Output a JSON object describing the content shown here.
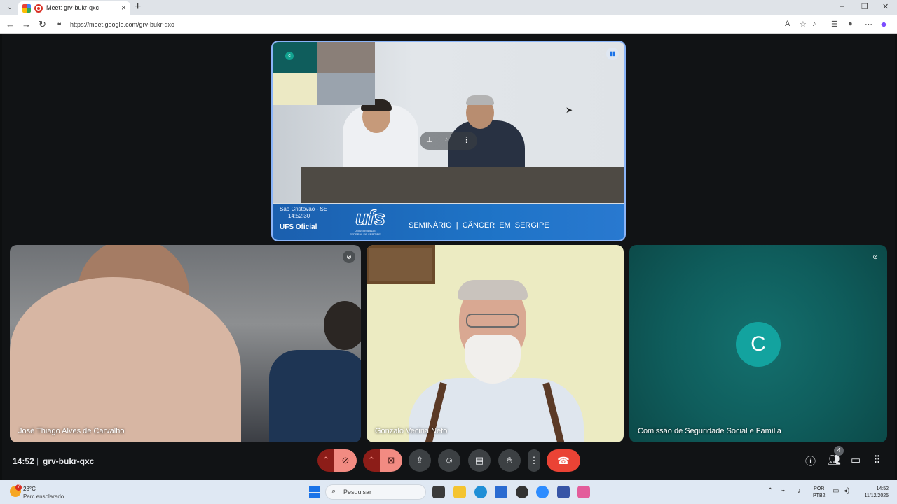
{
  "browser": {
    "tab_title": "Meet: grv-bukr-qxc",
    "url": "https://meet.google.com/grv-bukr-qxc"
  },
  "stage": {
    "overlay_city": "São Cristovão - SE",
    "overlay_time": "14:52:30",
    "channel": "UFS Oficial",
    "logo": "ufs",
    "logo_sub": "UNIVERSIDADE FEDERAL DE SERGIPE",
    "title": "SEMINÁRIO |  CÂNCER  EM  SERGIPE"
  },
  "participants": [
    {
      "name": "José Thiago Alves de Carvalho",
      "muted": true
    },
    {
      "name": "Gonzalo Vecina Neto",
      "muted": false
    },
    {
      "name": "Comissão de Seguridade Social e Família",
      "initial": "C",
      "muted": true
    }
  ],
  "meeting": {
    "time": "14:52",
    "code": "grv-bukr-qxc",
    "people_count": "4"
  },
  "taskbar": {
    "temperature": "28°C",
    "condition": "Parc ensolarado",
    "weather_alert": "7",
    "search_placeholder": "Pesquisar",
    "lang_line1": "POR",
    "lang_line2": "PTB2",
    "time": "14:52",
    "date": "11/12/2025"
  },
  "colors": {
    "hangup": "#ea4335",
    "muted_button": "#f28b82",
    "avatar": "#13a39f",
    "stage_border": "#8ab4f8"
  }
}
